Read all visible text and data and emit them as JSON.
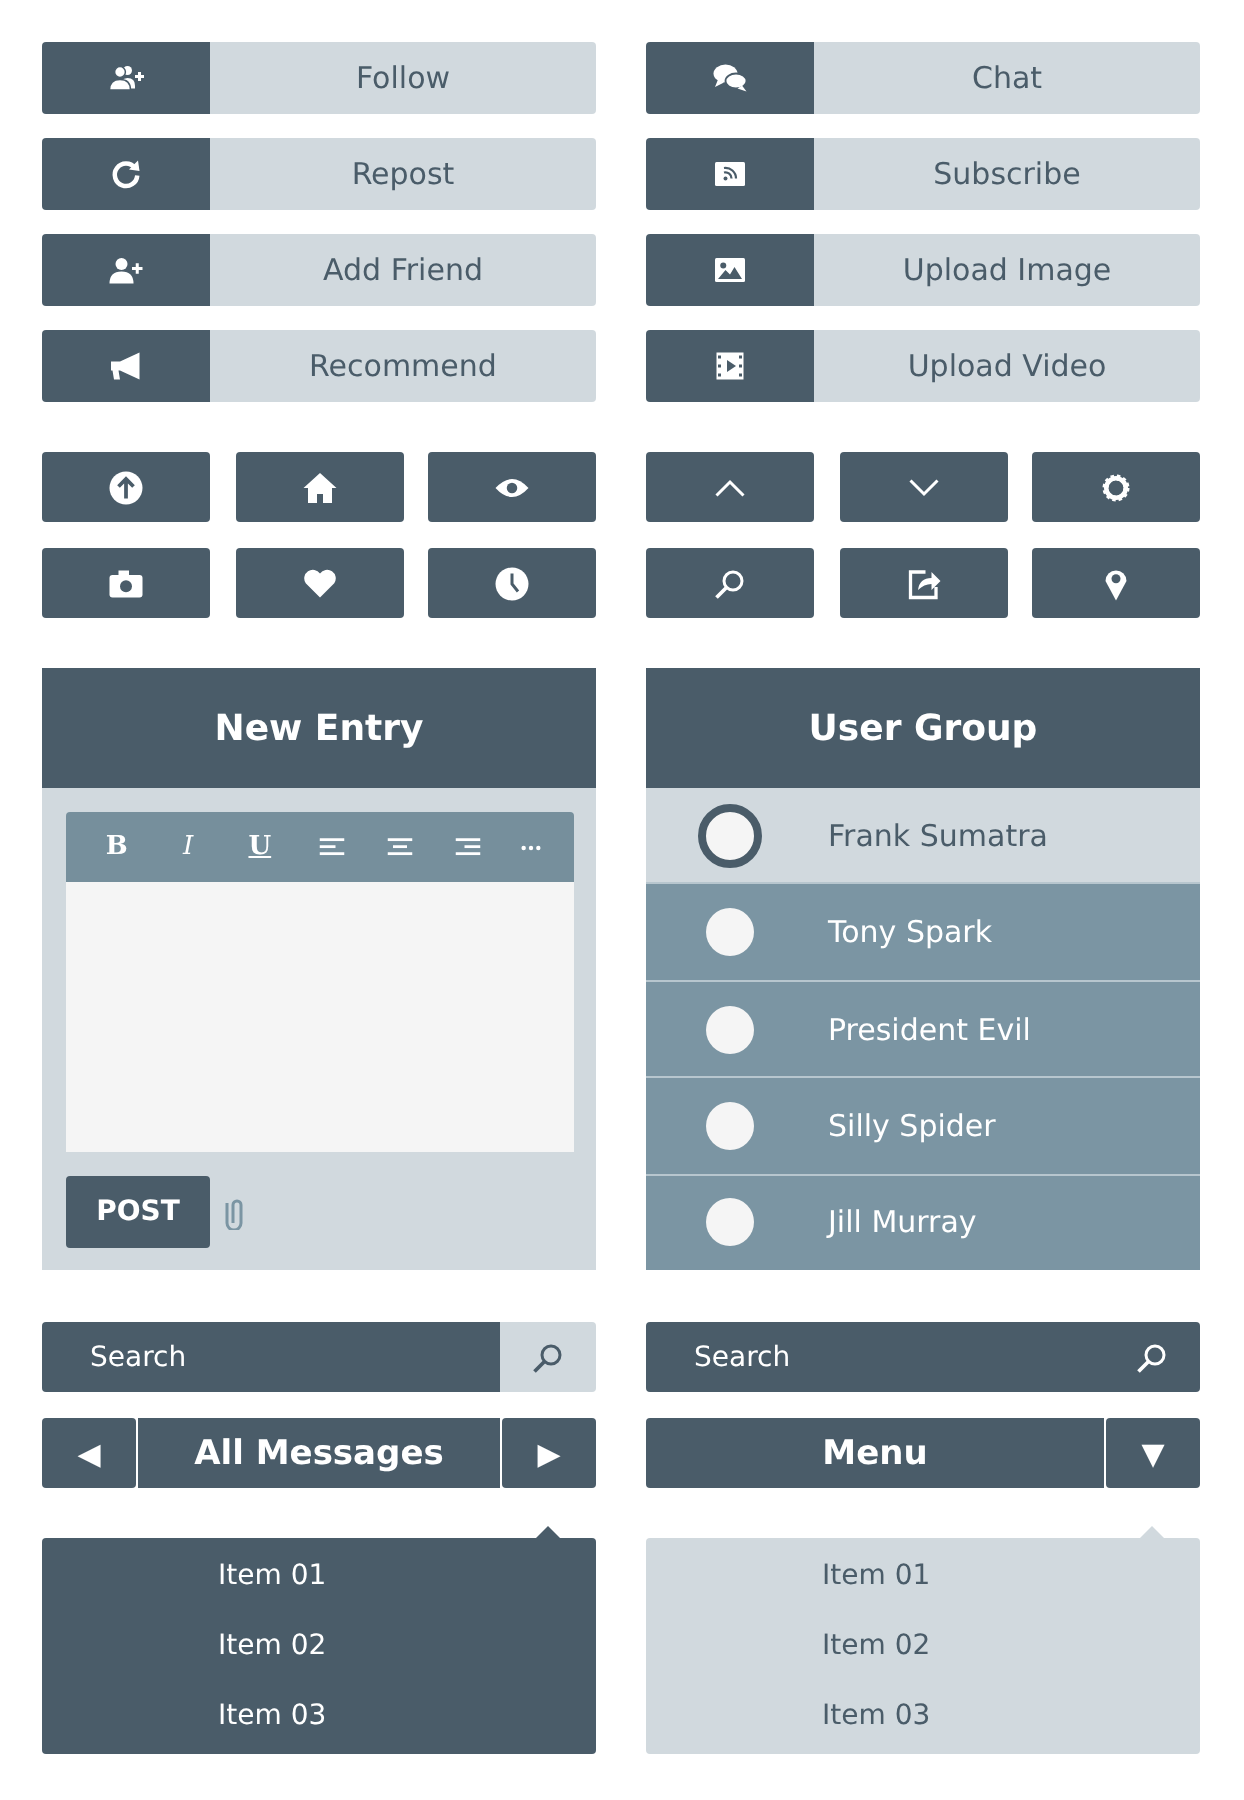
{
  "left_column": {
    "buttons": [
      {
        "label": "Follow"
      },
      {
        "label": "Repost"
      },
      {
        "label": "Add Friend"
      },
      {
        "label": "Recommend"
      }
    ],
    "panel": {
      "title": "New Entry",
      "toolbar": [
        {
          "label": "B",
          "kind": "bold"
        },
        {
          "label": "I",
          "kind": "italic"
        },
        {
          "label": "U",
          "kind": "underline"
        }
      ],
      "post_button": "POST"
    },
    "search": {
      "placeholder": "Search"
    },
    "pager": {
      "prev": "◀",
      "title": "All Messages",
      "next": "▶"
    },
    "dropdown": {
      "items": [
        "Item 01",
        "Item 02",
        "Item 03"
      ]
    }
  },
  "right_column": {
    "buttons": [
      {
        "label": "Chat"
      },
      {
        "label": "Subscribe"
      },
      {
        "label": "Upload Image"
      },
      {
        "label": "Upload Video"
      }
    ],
    "panel": {
      "title": "User Group",
      "users": [
        {
          "name": "Frank Sumatra",
          "selected": true
        },
        {
          "name": "Tony Spark",
          "selected": false
        },
        {
          "name": "President Evil",
          "selected": false
        },
        {
          "name": "Silly Spider",
          "selected": false
        },
        {
          "name": "Jill Murray",
          "selected": false
        }
      ]
    },
    "search": {
      "placeholder": "Search"
    },
    "menu": {
      "title": "Menu",
      "toggle": "▼"
    },
    "dropdown": {
      "items": [
        "Item 01",
        "Item 02",
        "Item 03"
      ]
    }
  }
}
